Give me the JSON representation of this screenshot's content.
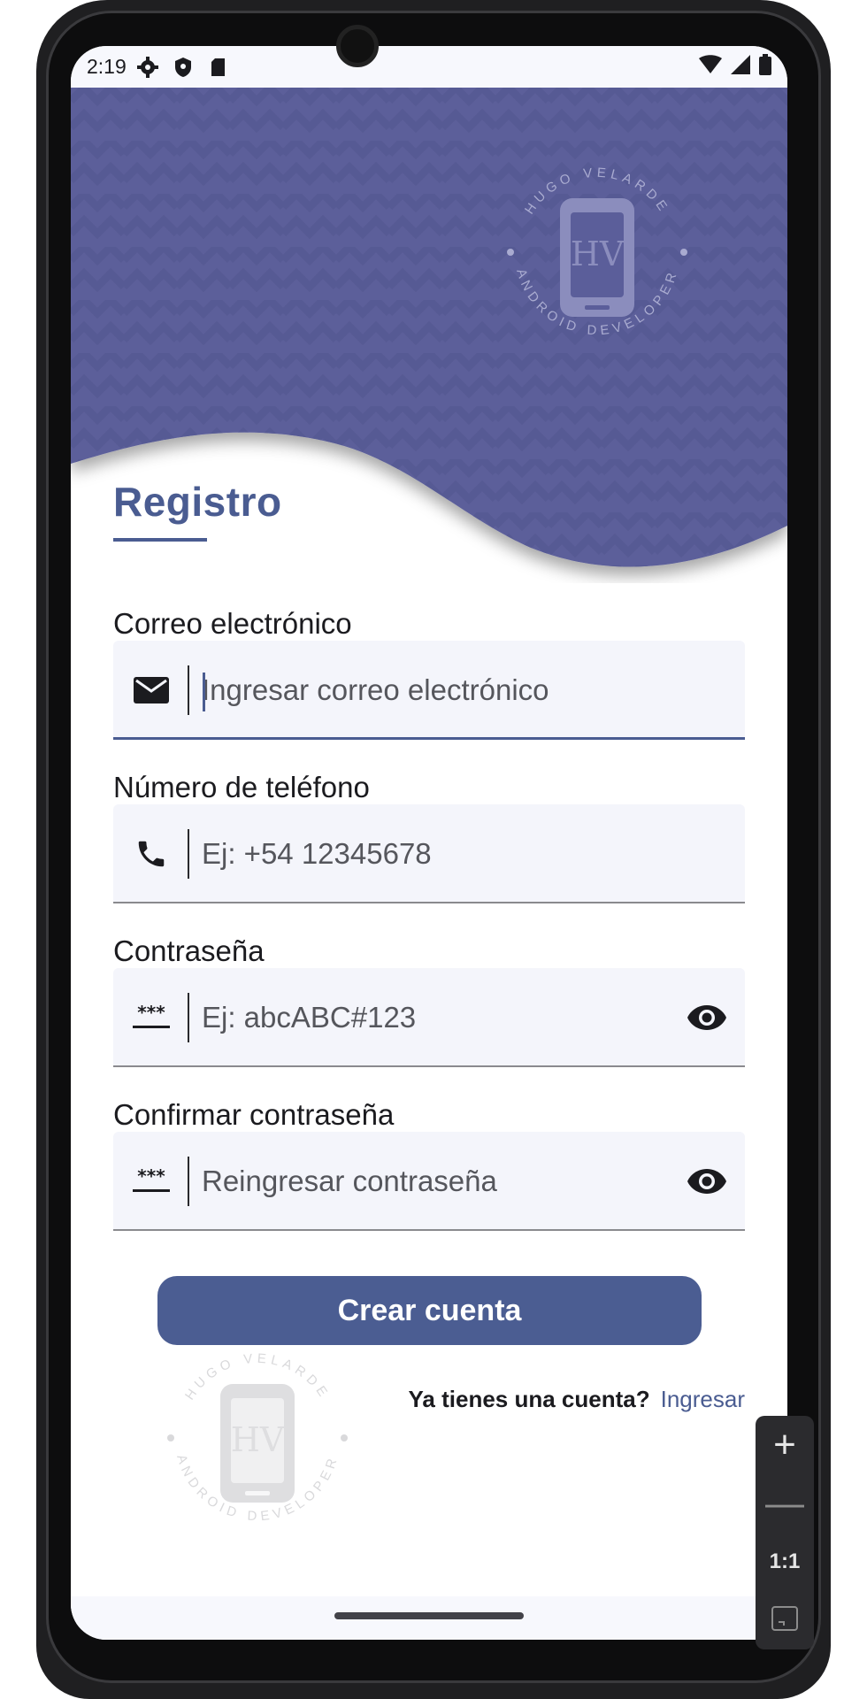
{
  "status_bar": {
    "time": "2:19",
    "icons": [
      "gear-icon",
      "shield-icon",
      "sd-card-icon"
    ],
    "right_icons": [
      "wifi-icon",
      "signal-icon",
      "battery-icon"
    ]
  },
  "header": {
    "background_color": "#5b5e9a",
    "logo": {
      "top_arc_text": "HUGO VELARDE",
      "bottom_arc_text": "ANDROID DEVELOPER",
      "monogram": "HV"
    }
  },
  "form": {
    "title": "Registro",
    "fields": [
      {
        "label": "Correo electrónico",
        "placeholder": "Ingresar correo electrónico",
        "icon": "mail-icon",
        "focused": true
      },
      {
        "label": "Número de teléfono",
        "placeholder": "Ej: +54 12345678",
        "icon": "phone-icon"
      },
      {
        "label": "Contraseña",
        "placeholder": "Ej: abcABC#123",
        "icon": "password-icon",
        "trailing_icon": "eye-icon"
      },
      {
        "label": "Confirmar contraseña",
        "placeholder": "Reingresar contraseña",
        "icon": "password-icon",
        "trailing_icon": "eye-icon"
      }
    ],
    "submit_label": "Crear cuenta"
  },
  "login_prompt": {
    "question": "Ya tienes una cuenta?",
    "link": "Ingresar"
  },
  "colors": {
    "accent": "#4a5c91",
    "field_bg": "#f4f5fb"
  },
  "emulator_controls": {
    "zoom_in": "+",
    "zoom_out": "—",
    "actual_size": "1:1"
  }
}
